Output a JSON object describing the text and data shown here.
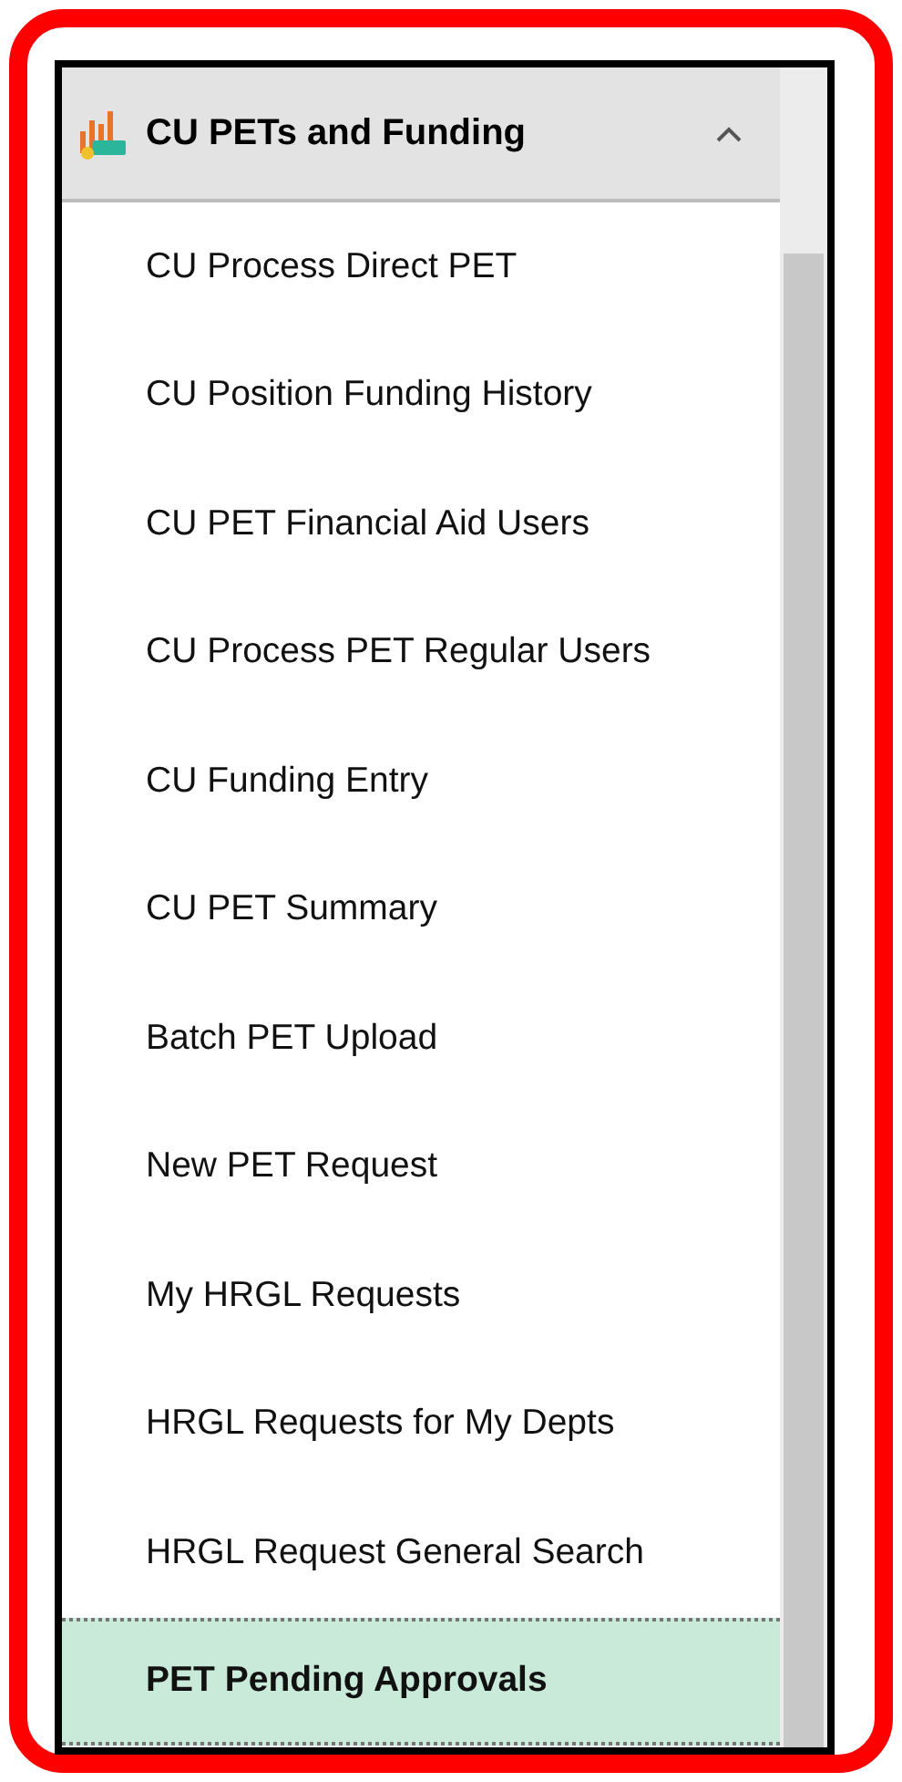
{
  "menu": {
    "title": "CU PETs and Funding",
    "expanded": true,
    "items": [
      {
        "label": "CU Process Direct PET",
        "selected": false
      },
      {
        "label": "CU Position Funding History",
        "selected": false
      },
      {
        "label": "CU PET Financial Aid Users",
        "selected": false
      },
      {
        "label": "CU Process PET Regular Users",
        "selected": false
      },
      {
        "label": "CU Funding Entry",
        "selected": false
      },
      {
        "label": "CU PET Summary",
        "selected": false
      },
      {
        "label": "Batch PET Upload",
        "selected": false
      },
      {
        "label": "New PET Request",
        "selected": false
      },
      {
        "label": "My HRGL Requests",
        "selected": false
      },
      {
        "label": "HRGL Requests for My Depts",
        "selected": false
      },
      {
        "label": "HRGL Request General Search",
        "selected": false
      },
      {
        "label": "PET Pending Approvals",
        "selected": true
      }
    ]
  }
}
